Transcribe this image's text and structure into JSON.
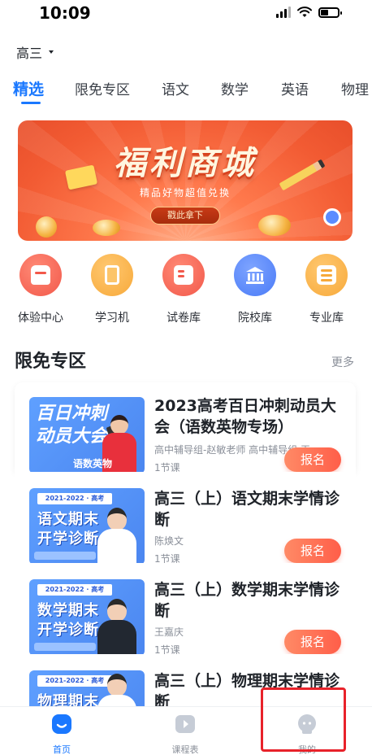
{
  "status_bar": {
    "time": "10:09"
  },
  "grade_selector": {
    "value": "高三"
  },
  "tabs": [
    {
      "label": "精选",
      "active": true
    },
    {
      "label": "限免专区",
      "active": false
    },
    {
      "label": "语文",
      "active": false
    },
    {
      "label": "数学",
      "active": false
    },
    {
      "label": "英语",
      "active": false
    },
    {
      "label": "物理",
      "active": false
    }
  ],
  "banner": {
    "title": "福利商城",
    "subtitle": "精品好物超值兑换",
    "button_label": "戳此拿下"
  },
  "quick_links": [
    {
      "label": "体验中心",
      "icon": "store-icon",
      "color": "#f2584a"
    },
    {
      "label": "学习机",
      "icon": "tablet-icon",
      "color": "#f7a93a"
    },
    {
      "label": "试卷库",
      "icon": "exam-paper-icon",
      "color": "#f2584a"
    },
    {
      "label": "院校库",
      "icon": "university-icon",
      "color": "#4a7bf7"
    },
    {
      "label": "专业库",
      "icon": "list-icon",
      "color": "#f7a93a"
    }
  ],
  "free_zone": {
    "title": "限免专区",
    "more_label": "更多",
    "courses": [
      {
        "title": "2023高考百日冲刺动员大会（语数英物专场）",
        "teacher": "高中辅导组-赵敏老师 高中辅导组 王",
        "lessons": "1节课",
        "enroll_label": "报名",
        "thumb_line1": "百日冲刺",
        "thumb_line2": "动员大会",
        "thumb_subject": "语数英物"
      },
      {
        "title": "高三（上）语文期末学情诊断",
        "teacher": "陈焕文",
        "lessons": "1节课",
        "enroll_label": "报名",
        "thumb_tag": "2021-2022 · 高考",
        "thumb_line1": "语文期末",
        "thumb_line2": "开学诊断"
      },
      {
        "title": "高三（上）数学期末学情诊断",
        "teacher": "王嘉庆",
        "lessons": "1节课",
        "enroll_label": "报名",
        "thumb_tag": "2021-2022 · 高考",
        "thumb_line1": "数学期末",
        "thumb_line2": "开学诊断"
      },
      {
        "title": "高三（上）物理期末学情诊断",
        "thumb_tag": "2021-2022 · 高考",
        "thumb_line1": "物理期末"
      }
    ]
  },
  "bottom_nav": [
    {
      "label": "首页",
      "icon": "home-icon",
      "active": true
    },
    {
      "label": "课程表",
      "icon": "schedule-icon",
      "active": false
    },
    {
      "label": "我的",
      "icon": "profile-icon",
      "active": false
    }
  ],
  "colors": {
    "accent": "#1a78ff",
    "enroll_button": "#ff5e49",
    "highlight": "#e8222a"
  }
}
